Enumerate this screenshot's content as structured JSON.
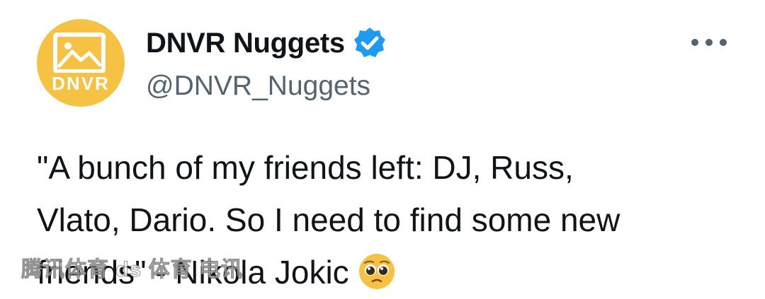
{
  "account": {
    "avatar_text": "DNVR",
    "display_name": "DNVR Nuggets",
    "handle": "@DNVR_Nuggets",
    "verified": true
  },
  "tweet": {
    "lines": [
      "\"A bunch of my friends left: DJ, Russ,",
      "Vlato, Dario. So I need to find some new",
      "friends\" - Nikola Jokic"
    ],
    "emoji": "pleading-face-emoji"
  },
  "watermark": {
    "text": "腾讯体育 ds 体育 电讯"
  },
  "icons": {
    "avatar": "dnvr-logo-icon",
    "verified": "verified-badge-icon",
    "more": "more-options-icon"
  },
  "colors": {
    "avatar_bg": "#f6c244",
    "verified_blue": "#1d9bf0",
    "handle_gray": "#536471",
    "text": "#0f1419"
  }
}
